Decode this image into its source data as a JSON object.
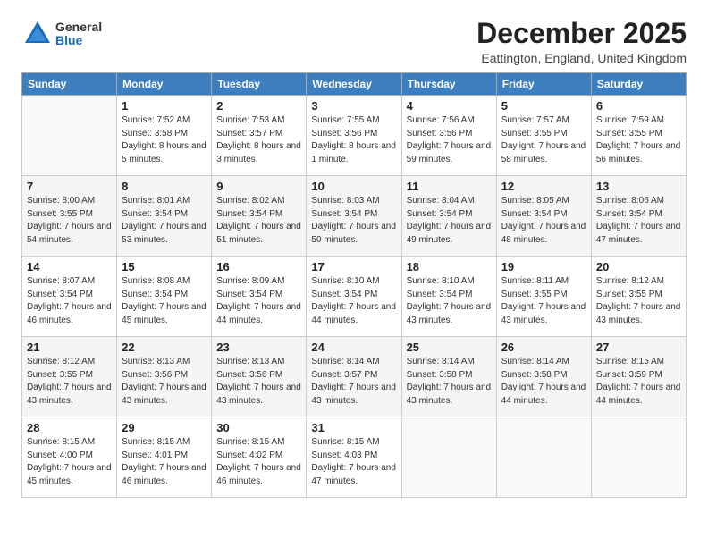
{
  "header": {
    "logo_general": "General",
    "logo_blue": "Blue",
    "month_title": "December 2025",
    "location": "Eattington, England, United Kingdom"
  },
  "weekdays": [
    "Sunday",
    "Monday",
    "Tuesday",
    "Wednesday",
    "Thursday",
    "Friday",
    "Saturday"
  ],
  "weeks": [
    [
      {
        "day": "",
        "sunrise": "",
        "sunset": "",
        "daylight": ""
      },
      {
        "day": "1",
        "sunrise": "Sunrise: 7:52 AM",
        "sunset": "Sunset: 3:58 PM",
        "daylight": "Daylight: 8 hours and 5 minutes."
      },
      {
        "day": "2",
        "sunrise": "Sunrise: 7:53 AM",
        "sunset": "Sunset: 3:57 PM",
        "daylight": "Daylight: 8 hours and 3 minutes."
      },
      {
        "day": "3",
        "sunrise": "Sunrise: 7:55 AM",
        "sunset": "Sunset: 3:56 PM",
        "daylight": "Daylight: 8 hours and 1 minute."
      },
      {
        "day": "4",
        "sunrise": "Sunrise: 7:56 AM",
        "sunset": "Sunset: 3:56 PM",
        "daylight": "Daylight: 7 hours and 59 minutes."
      },
      {
        "day": "5",
        "sunrise": "Sunrise: 7:57 AM",
        "sunset": "Sunset: 3:55 PM",
        "daylight": "Daylight: 7 hours and 58 minutes."
      },
      {
        "day": "6",
        "sunrise": "Sunrise: 7:59 AM",
        "sunset": "Sunset: 3:55 PM",
        "daylight": "Daylight: 7 hours and 56 minutes."
      }
    ],
    [
      {
        "day": "7",
        "sunrise": "Sunrise: 8:00 AM",
        "sunset": "Sunset: 3:55 PM",
        "daylight": "Daylight: 7 hours and 54 minutes."
      },
      {
        "day": "8",
        "sunrise": "Sunrise: 8:01 AM",
        "sunset": "Sunset: 3:54 PM",
        "daylight": "Daylight: 7 hours and 53 minutes."
      },
      {
        "day": "9",
        "sunrise": "Sunrise: 8:02 AM",
        "sunset": "Sunset: 3:54 PM",
        "daylight": "Daylight: 7 hours and 51 minutes."
      },
      {
        "day": "10",
        "sunrise": "Sunrise: 8:03 AM",
        "sunset": "Sunset: 3:54 PM",
        "daylight": "Daylight: 7 hours and 50 minutes."
      },
      {
        "day": "11",
        "sunrise": "Sunrise: 8:04 AM",
        "sunset": "Sunset: 3:54 PM",
        "daylight": "Daylight: 7 hours and 49 minutes."
      },
      {
        "day": "12",
        "sunrise": "Sunrise: 8:05 AM",
        "sunset": "Sunset: 3:54 PM",
        "daylight": "Daylight: 7 hours and 48 minutes."
      },
      {
        "day": "13",
        "sunrise": "Sunrise: 8:06 AM",
        "sunset": "Sunset: 3:54 PM",
        "daylight": "Daylight: 7 hours and 47 minutes."
      }
    ],
    [
      {
        "day": "14",
        "sunrise": "Sunrise: 8:07 AM",
        "sunset": "Sunset: 3:54 PM",
        "daylight": "Daylight: 7 hours and 46 minutes."
      },
      {
        "day": "15",
        "sunrise": "Sunrise: 8:08 AM",
        "sunset": "Sunset: 3:54 PM",
        "daylight": "Daylight: 7 hours and 45 minutes."
      },
      {
        "day": "16",
        "sunrise": "Sunrise: 8:09 AM",
        "sunset": "Sunset: 3:54 PM",
        "daylight": "Daylight: 7 hours and 44 minutes."
      },
      {
        "day": "17",
        "sunrise": "Sunrise: 8:10 AM",
        "sunset": "Sunset: 3:54 PM",
        "daylight": "Daylight: 7 hours and 44 minutes."
      },
      {
        "day": "18",
        "sunrise": "Sunrise: 8:10 AM",
        "sunset": "Sunset: 3:54 PM",
        "daylight": "Daylight: 7 hours and 43 minutes."
      },
      {
        "day": "19",
        "sunrise": "Sunrise: 8:11 AM",
        "sunset": "Sunset: 3:55 PM",
        "daylight": "Daylight: 7 hours and 43 minutes."
      },
      {
        "day": "20",
        "sunrise": "Sunrise: 8:12 AM",
        "sunset": "Sunset: 3:55 PM",
        "daylight": "Daylight: 7 hours and 43 minutes."
      }
    ],
    [
      {
        "day": "21",
        "sunrise": "Sunrise: 8:12 AM",
        "sunset": "Sunset: 3:55 PM",
        "daylight": "Daylight: 7 hours and 43 minutes."
      },
      {
        "day": "22",
        "sunrise": "Sunrise: 8:13 AM",
        "sunset": "Sunset: 3:56 PM",
        "daylight": "Daylight: 7 hours and 43 minutes."
      },
      {
        "day": "23",
        "sunrise": "Sunrise: 8:13 AM",
        "sunset": "Sunset: 3:56 PM",
        "daylight": "Daylight: 7 hours and 43 minutes."
      },
      {
        "day": "24",
        "sunrise": "Sunrise: 8:14 AM",
        "sunset": "Sunset: 3:57 PM",
        "daylight": "Daylight: 7 hours and 43 minutes."
      },
      {
        "day": "25",
        "sunrise": "Sunrise: 8:14 AM",
        "sunset": "Sunset: 3:58 PM",
        "daylight": "Daylight: 7 hours and 43 minutes."
      },
      {
        "day": "26",
        "sunrise": "Sunrise: 8:14 AM",
        "sunset": "Sunset: 3:58 PM",
        "daylight": "Daylight: 7 hours and 44 minutes."
      },
      {
        "day": "27",
        "sunrise": "Sunrise: 8:15 AM",
        "sunset": "Sunset: 3:59 PM",
        "daylight": "Daylight: 7 hours and 44 minutes."
      }
    ],
    [
      {
        "day": "28",
        "sunrise": "Sunrise: 8:15 AM",
        "sunset": "Sunset: 4:00 PM",
        "daylight": "Daylight: 7 hours and 45 minutes."
      },
      {
        "day": "29",
        "sunrise": "Sunrise: 8:15 AM",
        "sunset": "Sunset: 4:01 PM",
        "daylight": "Daylight: 7 hours and 46 minutes."
      },
      {
        "day": "30",
        "sunrise": "Sunrise: 8:15 AM",
        "sunset": "Sunset: 4:02 PM",
        "daylight": "Daylight: 7 hours and 46 minutes."
      },
      {
        "day": "31",
        "sunrise": "Sunrise: 8:15 AM",
        "sunset": "Sunset: 4:03 PM",
        "daylight": "Daylight: 7 hours and 47 minutes."
      },
      {
        "day": "",
        "sunrise": "",
        "sunset": "",
        "daylight": ""
      },
      {
        "day": "",
        "sunrise": "",
        "sunset": "",
        "daylight": ""
      },
      {
        "day": "",
        "sunrise": "",
        "sunset": "",
        "daylight": ""
      }
    ]
  ]
}
